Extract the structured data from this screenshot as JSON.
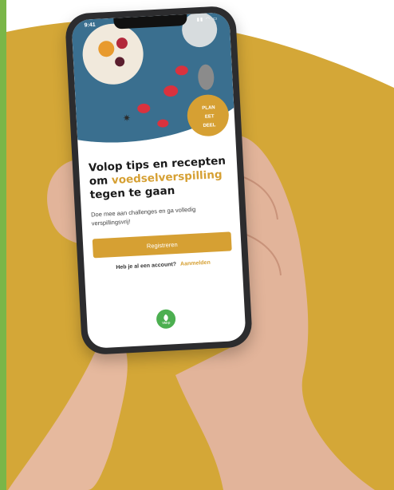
{
  "colors": {
    "accent": "#d6a033",
    "background_shape": "#d4a737",
    "green_strip": "#7ab648",
    "logo_green": "#4caf50"
  },
  "status_bar": {
    "time": "9:41",
    "icons": "signal-wifi-battery"
  },
  "hero": {
    "badge_line1": "PLAN",
    "badge_line2": "EET",
    "badge_line3": "DEEL"
  },
  "headline": {
    "part1": "Volop tips en recepten om ",
    "highlight": "voedselverspilling",
    "part2": " tegen te gaan"
  },
  "subtext": "Doe mee aan challenges en ga volledig verspillingsvrij!",
  "register_button": "Registreren",
  "login": {
    "prompt": "Heb je al een account?",
    "link": "Aanmelden"
  },
  "logo": {
    "icon": "leaf-icon",
    "text": "Vlerp"
  }
}
